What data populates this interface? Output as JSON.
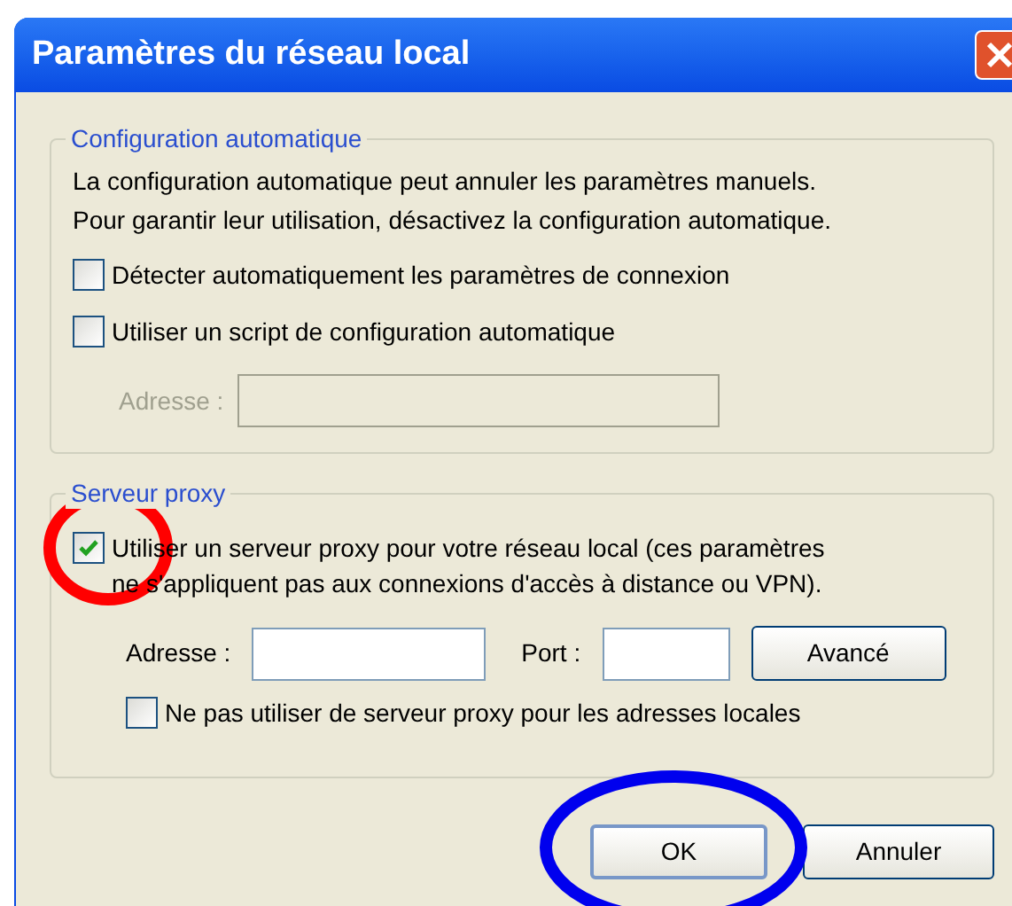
{
  "window": {
    "title": "Paramètres du réseau local"
  },
  "auto_config": {
    "legend": "Configuration automatique",
    "description": [
      "La configuration automatique peut annuler les paramètres manuels.",
      "Pour garantir leur utilisation, désactivez la configuration automatique."
    ],
    "options": [
      {
        "label": "Détecter automatiquement les paramètres de connexion",
        "checked": false
      },
      {
        "label": "Utiliser un script de configuration automatique",
        "checked": false
      }
    ],
    "address": {
      "label": "Adresse :",
      "disabled": true
    }
  },
  "proxy": {
    "legend": "Serveur proxy",
    "use_proxy": {
      "label": [
        "Utiliser un serveur proxy pour votre réseau local (ces paramètres",
        "ne s'appliquent pas aux connexions d'accès à distance ou VPN)."
      ],
      "checked": true
    },
    "address_label": "Adresse :",
    "port_label": "Port :",
    "advanced": "Avancé",
    "bypass": {
      "label": "Ne pas utiliser de serveur proxy pour les adresses locales",
      "checked": false
    }
  },
  "buttons": [
    {
      "label": "OK",
      "default": true
    },
    {
      "label": "Annuler",
      "default": false
    }
  ],
  "annotations": [
    {
      "kind": "ellipse",
      "color": "#ff0000"
    },
    {
      "kind": "ellipse",
      "color": "#0000ee"
    }
  ]
}
